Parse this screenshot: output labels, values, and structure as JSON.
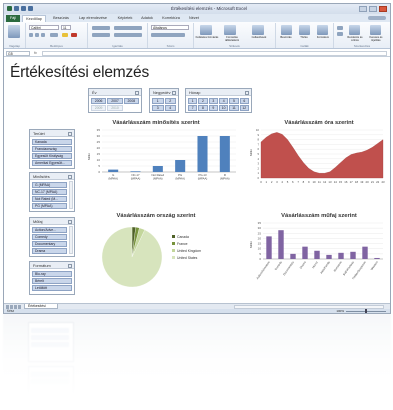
{
  "window": {
    "title": "Értékesítési elemzés - Microsoft Excel",
    "tabs": [
      "Fájl",
      "Kezdőlap",
      "Beszúrás",
      "Lap elrendezése",
      "Képletek",
      "Adatok",
      "Korrektúra",
      "Nézet"
    ],
    "active_tab": "Kezdőlap",
    "ribbon_groups": [
      "Vágólap",
      "Betűtípus",
      "Igazítás",
      "Szám",
      "Stílusok",
      "Cellák",
      "Szerkesztés"
    ],
    "font_name": "Calibri",
    "font_size": "11",
    "ribbon_labels": {
      "format": "Általános",
      "conditional": "Feltételes formázás",
      "as_table": "Formázás táblázatként",
      "cell_styles": "Cellastílusok",
      "insert": "Beszúrás",
      "delete": "Törlés",
      "format_cells": "Formátum",
      "sort": "Rendezés és szűrés",
      "find": "Keresés és kijelölés"
    }
  },
  "formula_bar": {
    "name_box": "G5",
    "fx": "fx"
  },
  "sheet": {
    "title": "Értékesítési elemzés"
  },
  "slicers": {
    "ev": {
      "title": "Év",
      "items": [
        "2006",
        "2007",
        "2008",
        "2009",
        "2010"
      ],
      "dim": [
        false,
        false,
        false,
        true,
        true
      ]
    },
    "negyedev": {
      "title": "Negyedév",
      "items": [
        "1",
        "2",
        "3",
        "4"
      ]
    },
    "honap": {
      "title": "Hónap",
      "items": [
        "1",
        "2",
        "3",
        "4",
        "5",
        "6",
        "7",
        "8",
        "9",
        "10",
        "11",
        "12"
      ]
    },
    "terules": {
      "title": "Terület",
      "items": [
        "Kanada",
        "Franciaország",
        "Egyesült Királyság",
        "Amerikai Egyesült..."
      ]
    },
    "minosites": {
      "title": "Minősítés",
      "items": [
        "G (MPAA)",
        "NC-17 (MPAA)",
        "Not Rated (M...",
        "PG (MPAA)"
      ]
    },
    "mufaj": {
      "title": "Műfaj",
      "items": [
        "Action/Adve...",
        "Comedy",
        "Documentary",
        "Drama"
      ]
    },
    "formatum": {
      "title": "Formátum",
      "items": [
        "Blu-ray",
        "Bérelt",
        "Letöltött"
      ]
    }
  },
  "sheet_tabs": {
    "active": "Értékesítési elemzés"
  },
  "status_bar": {
    "ready": "Kész",
    "zoom": "100%"
  },
  "colors": {
    "blue": "#4f81bd",
    "red": "#c0504d",
    "green": "#9bbb59",
    "purple": "#8064a2"
  },
  "chart_data": [
    {
      "type": "bar",
      "title": "Vásárlásszám minősítés szerint",
      "ylabel": "Millió",
      "categories": [
        "G (MPAA)",
        "NC-17 (MPAA)",
        "Not Rated (MPAA)",
        "PG (MPAA)",
        "PG-13 (MPAA)",
        "R (MPAA)"
      ],
      "values": [
        2,
        0.6,
        5,
        10,
        30,
        30
      ],
      "ylim": [
        0,
        35
      ],
      "yticks": [
        "0",
        "5",
        "10",
        "15",
        "20",
        "25",
        "30",
        "35"
      ]
    },
    {
      "type": "area",
      "title": "Vásárlásszám óra szerint",
      "ylabel": "Millió",
      "x": [
        0,
        1,
        2,
        3,
        4,
        5,
        6,
        7,
        8,
        9,
        10,
        11,
        12,
        13,
        14,
        15,
        16,
        17,
        18,
        19,
        20,
        21,
        22,
        23
      ],
      "values": [
        7.5,
        8.5,
        9.2,
        9.5,
        9.1,
        8.0,
        6.4,
        4.7,
        3.2,
        2.0,
        1.3,
        1.0,
        1.0,
        1.3,
        2.2,
        3.2,
        4.2,
        4.9,
        5.2,
        5.4,
        5.8,
        6.4,
        7.2,
        8.0
      ],
      "ylim": [
        0,
        10
      ],
      "yticks": [
        "0",
        "1",
        "2",
        "3",
        "4",
        "5",
        "6",
        "7",
        "8",
        "9",
        "10"
      ]
    },
    {
      "type": "pie",
      "title": "Vásárlásszám ország szerint",
      "categories": [
        "Canada",
        "France",
        "United Kingdom",
        "United States"
      ],
      "values": [
        2,
        2,
        3,
        93
      ]
    },
    {
      "type": "bar",
      "title": "Vásárlásszám műfaj szerint",
      "ylabel": "Millió",
      "categories": [
        "Action/Adventure",
        "Comedy",
        "Documentary",
        "Drama",
        "Horror",
        "Kids/Family",
        "Romance",
        "SciFi/Fantasy",
        "Thriller/Suspense",
        "Western"
      ],
      "values": [
        22,
        28,
        5,
        12,
        8,
        4,
        6,
        7,
        12,
        1
      ],
      "ylim": [
        0,
        35
      ],
      "yticks": [
        "0",
        "5",
        "10",
        "15",
        "20",
        "25",
        "30",
        "35"
      ]
    }
  ]
}
